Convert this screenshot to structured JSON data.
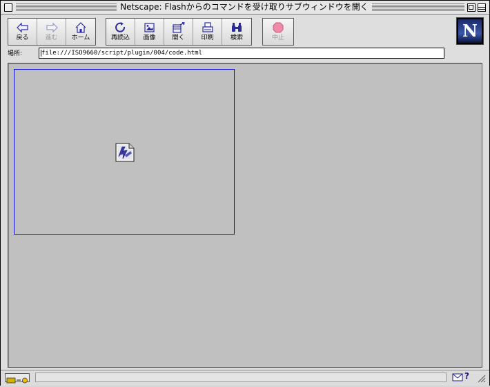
{
  "window": {
    "title": "Netscape: Flashからのコマンドを受け取りサブウィンドウを開く"
  },
  "toolbar": {
    "back_label": "戻る",
    "forward_label": "進む",
    "home_label": "ホーム",
    "reload_label": "再読込",
    "images_label": "画像",
    "open_label": "開く",
    "print_label": "印刷",
    "find_label": "検索",
    "stop_label": "中止",
    "logo_letter": "N"
  },
  "location": {
    "label": "場所:",
    "url": "file:///ISO9660/script/plugin/004/code.html"
  },
  "statusbar": {
    "text": ""
  },
  "colors": {
    "content_bg": "#c0c0c0",
    "embed_border": "#1010e0",
    "icon_accent": "#3a3aa8"
  }
}
